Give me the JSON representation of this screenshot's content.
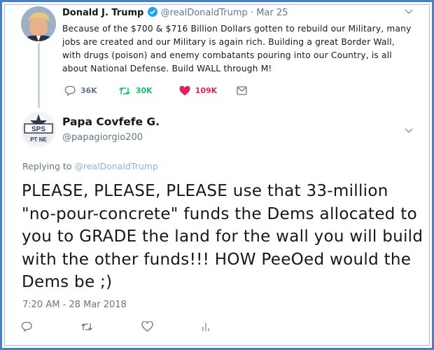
{
  "parent_tweet": {
    "author_name": "Donald J. Trump",
    "author_handle": "@realDonaldTrump",
    "separator": "·",
    "date": "Mar 25",
    "text": "Because of the $700 & $716 Billion Dollars gotten to rebuild our Military, many jobs are created and our Military is again rich. Building a great Border Wall, with drugs (poison) and enemy combatants pouring into our Country, is all about National Defense. Build WALL through M!",
    "reply_count": "36K",
    "retweet_count": "30K",
    "like_count": "109K"
  },
  "reply_tweet": {
    "author_name": "Papa Covfefe G.",
    "author_handle": "@papagiorgio200",
    "avatar_text": "PT NE",
    "replying_label": "Replying to",
    "replying_to": "@realDonaldTrump",
    "text": "PLEASE, PLEASE, PLEASE use that 33-million \"no-pour-concrete\" funds the Dems allocated to you to GRADE the land for the wall you will build with the other funds!!! HOW PeeOed would the Dems be ;)",
    "timestamp": "7:20 AM - 28 Mar 2018"
  },
  "colors": {
    "text": "#14171a",
    "muted": "#657786",
    "retweet": "#17bf63",
    "like": "#e0245e",
    "verified": "#1da1f2",
    "frame": "#4a7fc8"
  },
  "icons": {
    "parent_actions": [
      "reply-icon",
      "retweet-icon",
      "heart-icon",
      "message-icon"
    ],
    "reply_actions": [
      "reply-icon",
      "retweet-icon",
      "heart-icon",
      "analytics-icon"
    ]
  }
}
